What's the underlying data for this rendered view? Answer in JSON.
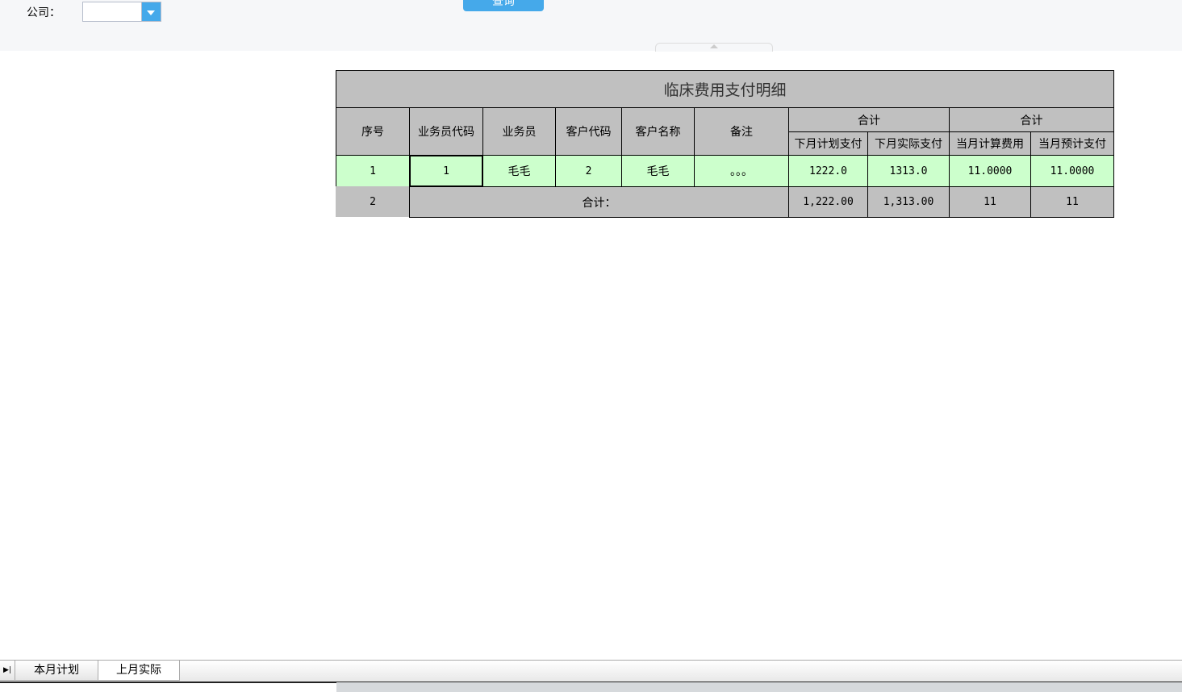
{
  "filter": {
    "company_label": "公司：",
    "company_value": "",
    "query_button": "查询"
  },
  "table": {
    "title": "临床费用支付明细",
    "headers": {
      "seq": "序号",
      "staff_code": "业务员代码",
      "staff": "业务员",
      "cust_code": "客户代码",
      "cust_name": "客户名称",
      "remark": "备注",
      "group1": "合计",
      "group2": "合计",
      "next_plan": "下月计划支付",
      "next_actual": "下月实际支付",
      "cur_calc": "当月计算费用",
      "cur_est": "当月预计支付"
    },
    "rows": [
      {
        "seq": "1",
        "staff_code": "1",
        "staff": "毛毛",
        "cust_code": "2",
        "cust_name": "毛毛",
        "remark": "。。。",
        "next_plan": "1222.0",
        "next_actual": "1313.0",
        "cur_calc": "11.0000",
        "cur_est": "11.0000"
      }
    ],
    "total": {
      "seq": "2",
      "label": "合计：",
      "next_plan": "1,222.00",
      "next_actual": "1,313.00",
      "cur_calc": "11",
      "cur_est": "11"
    }
  },
  "sheet_tabs": [
    "本月计划",
    "上月实际"
  ]
}
